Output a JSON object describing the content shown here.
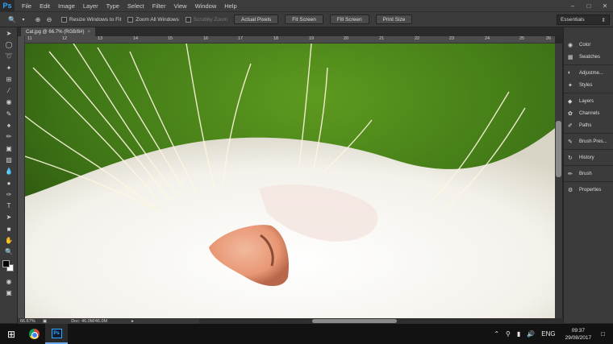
{
  "app": {
    "logo": "Ps"
  },
  "menu": [
    "File",
    "Edit",
    "Image",
    "Layer",
    "Type",
    "Select",
    "Filter",
    "View",
    "Window",
    "Help"
  ],
  "options": {
    "resize_windows": "Resize Windows to Fit",
    "zoom_all_windows": "Zoom All Windows",
    "scrubby_zoom": "Scrubby Zoom",
    "actual_pixels": "Actual Pixels",
    "fit_screen": "Fit Screen",
    "fill_screen": "Fill Screen",
    "print_size": "Print Size",
    "workspace": "Essentials"
  },
  "document": {
    "tab_title": "Cat.jpg @ 66.7% (RGB/8#)",
    "ruler_marks": [
      "11",
      "12",
      "13",
      "14",
      "15",
      "16",
      "17",
      "18",
      "19",
      "20",
      "21",
      "22",
      "23",
      "24",
      "25",
      "26"
    ],
    "zoom": "66.67%",
    "doc_info": "Doc: 46.0M/46.0M"
  },
  "panels": [
    "Color",
    "Swatches",
    "Adjustme...",
    "Styles",
    "Layers",
    "Channels",
    "Paths",
    "Brush Pres...",
    "History",
    "Brush",
    "Properties"
  ],
  "taskbar": {
    "language": "ENG",
    "time": "09:37",
    "date": "29/08/2017"
  }
}
